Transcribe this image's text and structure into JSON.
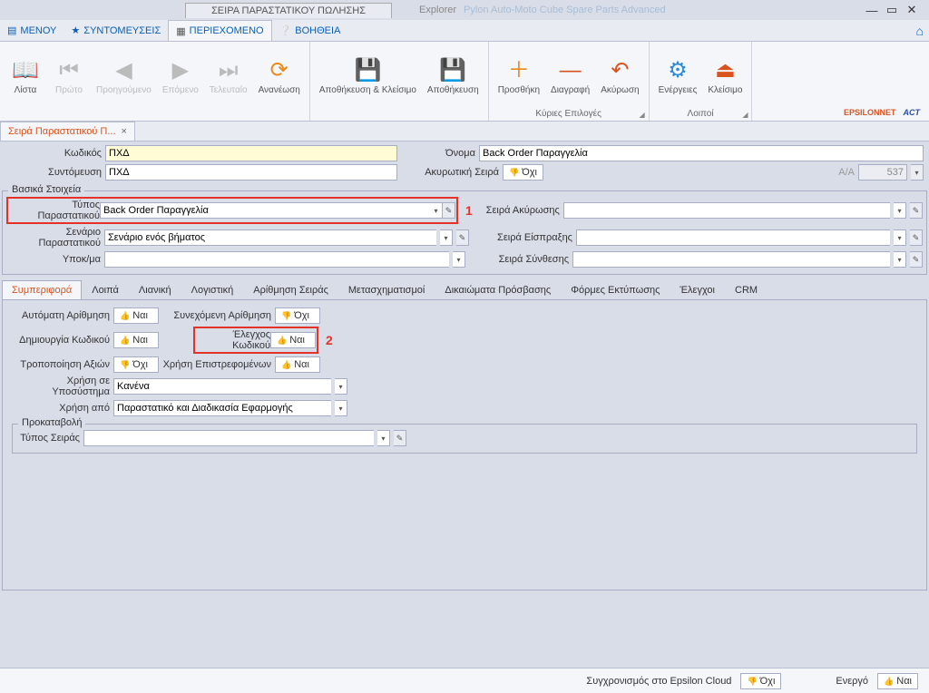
{
  "window": {
    "tab_title": "ΣΕΙΡΑ ΠΑΡΑΣΤΑΤΙΚΟΥ ΠΩΛΗΣΗΣ",
    "explorer_label": "Explorer",
    "app_title": "Pylon Auto-Moto Cube Spare Parts Advanced"
  },
  "menu": {
    "menu": "ΜΕΝΟΥ",
    "shortcuts": "ΣΥΝΤΟΜΕΥΣΕΙΣ",
    "content": "ΠΕΡΙΕΧΟΜΕΝΟ",
    "help": "ΒΟΗΘΕΙΑ"
  },
  "ribbon": {
    "list": "Λίστα",
    "first": "Πρώτο",
    "prev": "Προηγούμενο",
    "next": "Επόμενο",
    "last": "Τελευταίο",
    "refresh": "Ανανέωση",
    "save_close": "Αποθήκευση & Κλείσιμο",
    "save": "Αποθήκευση",
    "add": "Προσθήκη",
    "delete": "Διαγραφή",
    "cancel": "Ακύρωση",
    "actions": "Ενέργειες",
    "close": "Κλείσιμο",
    "group_main": "Κύριες Επιλογές",
    "group_other": "Λοιποί",
    "logo1": "EPSILONNET",
    "logo2": "ACT"
  },
  "doctab": {
    "label": "Σειρά Παραστατικού Π..."
  },
  "top_form": {
    "code_lbl": "Κωδικός",
    "code_val": "ΠΧΔ",
    "name_lbl": "Όνομα",
    "name_val": "Back Order Παραγγελία",
    "abbrev_lbl": "Συντόμευση",
    "abbrev_val": "ΠΧΔ",
    "cancel_series_lbl": "Ακυρωτική Σειρά",
    "cancel_series_val": "Όχι",
    "aa_lbl": "A/A",
    "aa_val": "537"
  },
  "basic": {
    "legend": "Βασικά Στοιχεία",
    "doc_type_lbl": "Τύπος Παραστατικού",
    "doc_type_val": "Back Order Παραγγελία",
    "scenario_lbl": "Σενάριο Παραστατικού",
    "scenario_val": "Σενάριο ενός βήματος",
    "branch_lbl": "Υποκ/μα",
    "branch_val": "",
    "cancel_series_lbl": "Σειρά Ακύρωσης",
    "collect_series_lbl": "Σειρά Είσπραξης",
    "compose_series_lbl": "Σειρά Σύνθεσης"
  },
  "subtabs": {
    "behavior": "Συμπεριφορά",
    "other": "Λοιπά",
    "retail": "Λιανική",
    "accounting": "Λογιστική",
    "numbering": "Αρίθμηση Σειράς",
    "transform": "Μετασχηματισμοί",
    "access": "Δικαιώματα Πρόσβασης",
    "print_forms": "Φόρμες Εκτύπωσης",
    "checks": "Έλεγχοι",
    "crm": "CRM"
  },
  "behavior": {
    "auto_num_lbl": "Αυτόματη Αρίθμηση",
    "auto_num_val": "Ναι",
    "cont_num_lbl": "Συνεχόμενη Αρίθμηση",
    "cont_num_val": "Όχι",
    "create_code_lbl": "Δημιουργία Κωδικού",
    "create_code_val": "Ναι",
    "check_code_lbl": "Έλεγχος Κωδικού",
    "check_code_val": "Ναι",
    "modify_values_lbl": "Τροποποίηση Αξιών",
    "modify_values_val": "Όχι",
    "use_returned_lbl": "Χρήση Επιστρεφομένων",
    "use_returned_val": "Ναι",
    "use_subsystem_lbl": "Χρήση σε Υποσύστημα",
    "use_subsystem_val": "Κανένα",
    "use_from_lbl": "Χρήση από",
    "use_from_val": "Παραστατικό και Διαδικασία Εφαρμογής",
    "prepay_legend": "Προκαταβολή",
    "series_type_lbl": "Τύπος Σειράς"
  },
  "bottom": {
    "sync_lbl": "Συγχρονισμός στο Epsilon Cloud",
    "sync_val": "Όχι",
    "active_lbl": "Ενεργό",
    "active_val": "Ναι"
  },
  "annotations": {
    "one": "1",
    "two": "2"
  }
}
